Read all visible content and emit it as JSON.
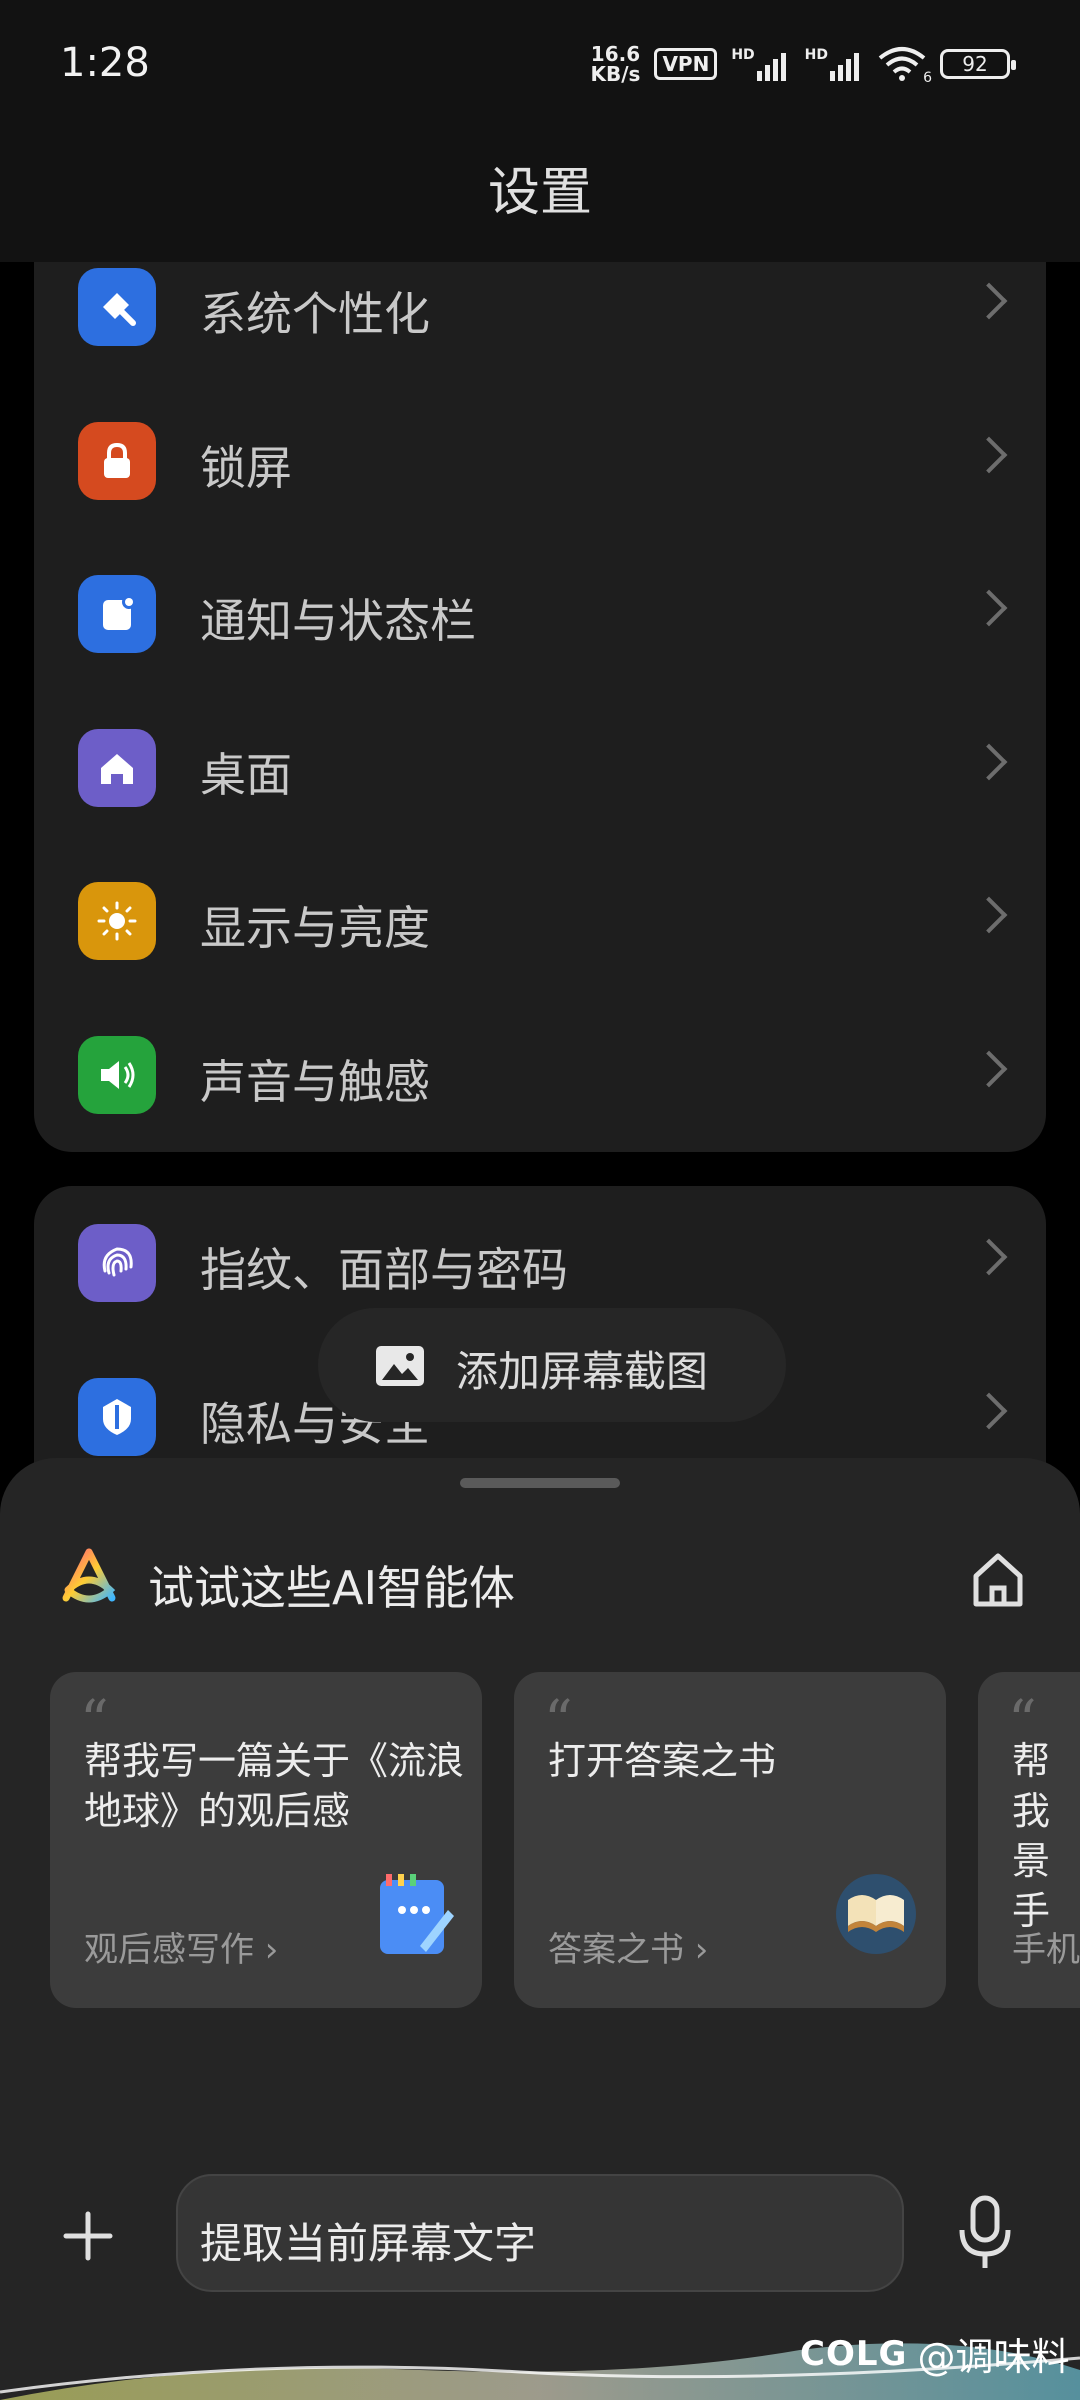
{
  "status_bar": {
    "time": "1:28",
    "speed_value": "16.6",
    "speed_unit": "KB/s",
    "vpn": "VPN",
    "hd1": "HD",
    "hd2": "HD",
    "wifi_num": "6",
    "battery": "92"
  },
  "header": {
    "title": "设置"
  },
  "settings_group_1": [
    {
      "label": "系统个性化",
      "icon": "paintbrush-icon",
      "color": "#2d6fe0"
    },
    {
      "label": "锁屏",
      "icon": "lock-icon",
      "color": "#d54a1f"
    },
    {
      "label": "通知与状态栏",
      "icon": "notification-icon",
      "color": "#2d6fe0"
    },
    {
      "label": "桌面",
      "icon": "home-icon",
      "color": "#6d5ec8"
    },
    {
      "label": "显示与亮度",
      "icon": "sun-icon",
      "color": "#d9960c"
    },
    {
      "label": "声音与触感",
      "icon": "speaker-icon",
      "color": "#25a33c"
    }
  ],
  "settings_group_2": [
    {
      "label": "指纹、面部与密码",
      "icon": "fingerprint-icon",
      "color": "#6d5ec8"
    },
    {
      "label": "隐私与安全",
      "icon": "shield-icon",
      "color": "#2d6fe0"
    }
  ],
  "screenshot_pill": {
    "label": "添加屏幕截图",
    "icon": "image-icon"
  },
  "ai_sheet": {
    "title": "试试这些AI智能体",
    "logo_icon": "ai-logo-icon",
    "home_icon": "home-outline-icon",
    "suggestions": [
      {
        "text": "帮我写一篇关于《流浪地球》的观后感",
        "tag": "观后感写作 ›",
        "icon": "notepad-icon"
      },
      {
        "text": "打开答案之书",
        "tag": "答案之书 ›",
        "icon": "book-icon"
      },
      {
        "text": "帮我景手",
        "tag": "手机",
        "icon": ""
      }
    ],
    "input_text": "提取当前屏幕文字",
    "plus_icon": "plus-icon",
    "mic_icon": "microphone-icon"
  },
  "watermark": {
    "brand": "COLG",
    "handle": "@调味料"
  }
}
